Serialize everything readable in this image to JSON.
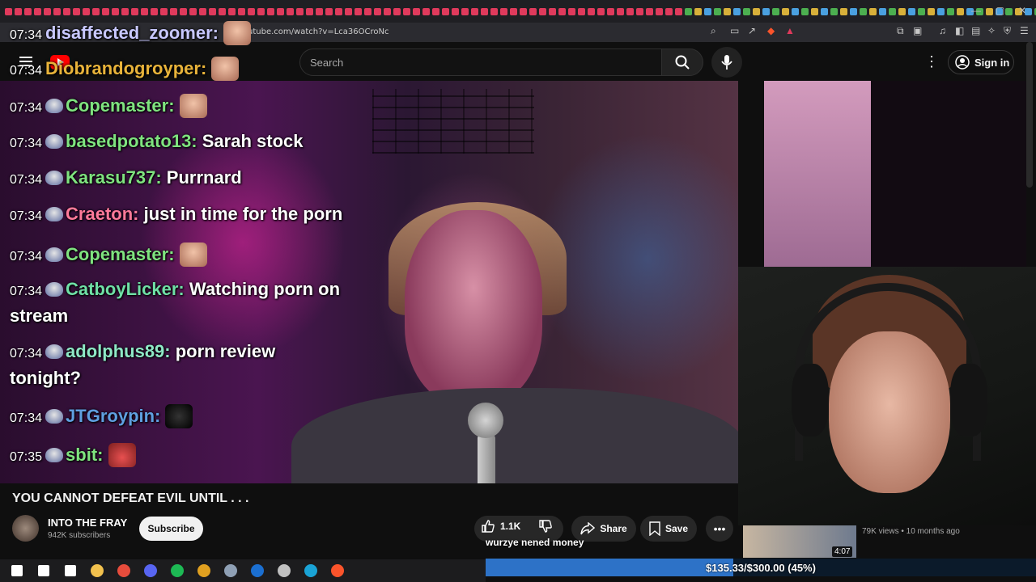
{
  "browser": {
    "url": "youtube.com/watch?v=Lca36OCroNc",
    "tab_colors": [
      "#e03a5c",
      "#e03a5c",
      "#e03a5c",
      "#4aa0e0",
      "#4caf50",
      "#d8b03a"
    ]
  },
  "youtube": {
    "search_placeholder": "Search",
    "sign_in_label": "Sign in",
    "logo_text": "Tube"
  },
  "chat": {
    "messages": [
      {
        "time": "07:34",
        "user": "disaffected_zoomer:",
        "user_color": "#c8c8ff",
        "text": ""
      },
      {
        "time": "07:34",
        "user": "Diobrandogroyper:",
        "user_color": "#e8b33a",
        "text": ""
      },
      {
        "time": "07:34",
        "user": "Copemaster:",
        "user_color": "#7fe37f",
        "text": ""
      },
      {
        "time": "07:34",
        "user": "basedpotato13:",
        "user_color": "#7fe37f",
        "text": "Sarah stock"
      },
      {
        "time": "07:34",
        "user": "Karasu737:",
        "user_color": "#7fe37f",
        "text": "Purrnard"
      },
      {
        "time": "07:34",
        "user": "Craeton:",
        "user_color": "#ff7a9a",
        "text": "just in time for the porn"
      },
      {
        "time": "07:34",
        "user": "Copemaster:",
        "user_color": "#7fe37f",
        "text": ""
      },
      {
        "time": "07:34",
        "user": "CatboyLicker:",
        "user_color": "#6fe0a6",
        "text": "Watching porn on",
        "text2": "stream"
      },
      {
        "time": "07:34",
        "user": "adolphus89:",
        "user_color": "#8ee8c6",
        "text": "porn review",
        "text2": "tonight?"
      },
      {
        "time": "07:34",
        "user": "JTGroypin:",
        "user_color": "#5f9fe0",
        "text": ""
      },
      {
        "time": "07:35",
        "user": "sbit:",
        "user_color": "#7fe37f",
        "text": ""
      }
    ]
  },
  "video": {
    "title": "YOU CANNOT DEFEAT EVIL UNTIL . . .",
    "channel_name": "INTO THE FRAY",
    "subscribers": "942K subscribers",
    "subscribe_label": "Subscribe",
    "like_count": "1.1K",
    "share_label": "Share",
    "save_label": "Save"
  },
  "donation": {
    "message": "wurzye nened money",
    "goal_text": "$135.33/$300.00 (45%)",
    "progress": 0.45
  },
  "recommended": {
    "duration": "4:07",
    "meta": "79K views • 10 months ago"
  },
  "taskbar": {
    "icons": [
      "windows-icon",
      "search-icon",
      "task-view-icon",
      "file-explorer-icon",
      "obs-icon",
      "discord-icon",
      "spotify-icon",
      "chrome-icon",
      "app-icon",
      "steam-icon",
      "app-icon-2",
      "edge-icon",
      "brave-icon"
    ],
    "colors": [
      "#ffffff",
      "#ffffff",
      "#ffffff",
      "#f2c14e",
      "#e74c3c",
      "#5865f2",
      "#1db954",
      "#e0a020",
      "#8fa0b5",
      "#1b6fd1",
      "#c0c0c0",
      "#1aa3d6",
      "#fb542b"
    ]
  }
}
